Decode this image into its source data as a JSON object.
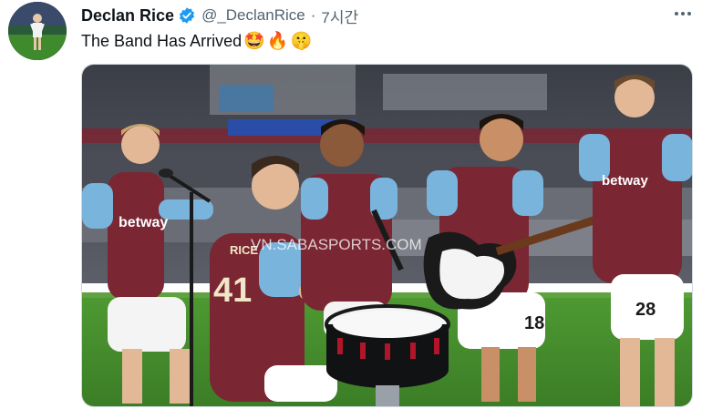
{
  "tweet": {
    "author_name": "Declan Rice",
    "handle": "@_DeclanRice",
    "separator": "·",
    "time": "7시간",
    "text": "The Band Has Arrived",
    "emojis": [
      "🤩",
      "🔥",
      "🤫"
    ],
    "more_icon": "more-horizontal-icon",
    "verified_icon": "verified-badge-icon"
  },
  "photo": {
    "watermark": "VN.SABASPORTS.COM",
    "shirt_sponsor": "betway",
    "shirt_name": "RICE",
    "shirt_number_rice": "41",
    "shirt_number_benrahma": "18",
    "shirt_number_coufal": "28"
  },
  "colors": {
    "claret": "#7a2633",
    "sky_blue": "#79b4dc",
    "pitch_green": "#3f8a2c",
    "verified_blue": "#1d9bf0",
    "text_secondary": "#536471"
  }
}
